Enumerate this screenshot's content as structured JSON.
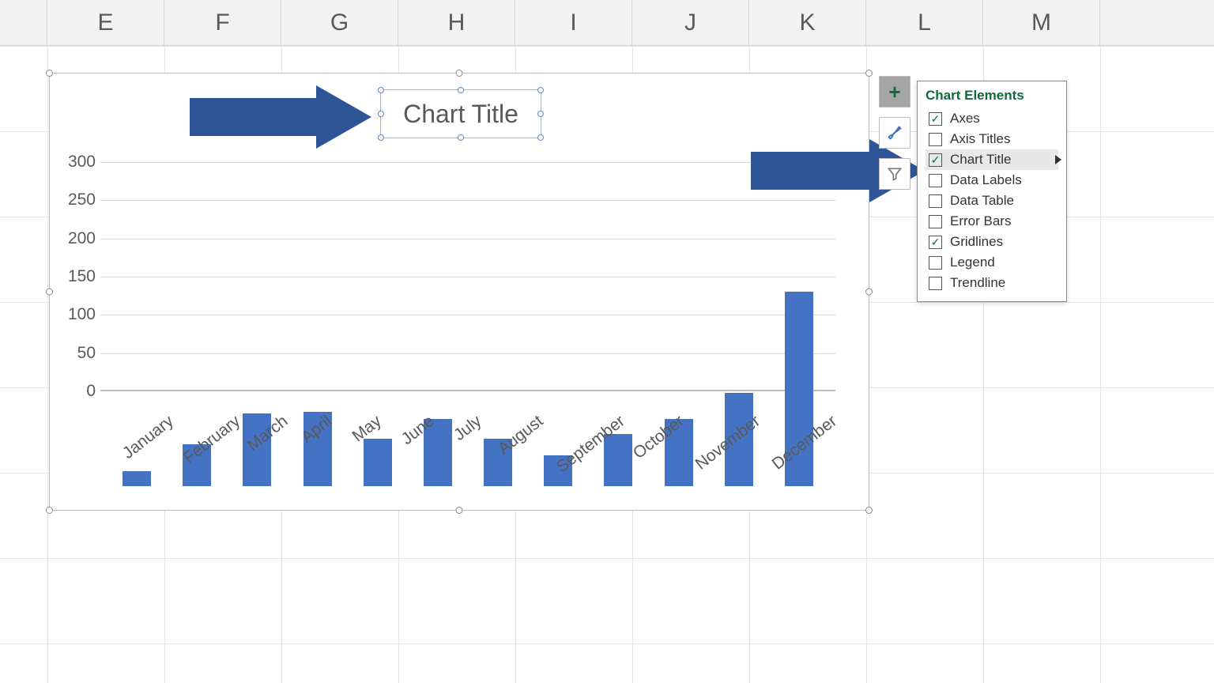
{
  "columns": [
    "E",
    "F",
    "G",
    "H",
    "I",
    "J",
    "K",
    "L",
    "M"
  ],
  "chart": {
    "title": "Chart Title"
  },
  "chart_data": {
    "type": "bar",
    "title": "Chart Title",
    "categories": [
      "January",
      "February",
      "March",
      "April",
      "May",
      "June",
      "July",
      "August",
      "September",
      "October",
      "November",
      "December"
    ],
    "values": [
      20,
      55,
      95,
      97,
      62,
      88,
      62,
      40,
      68,
      88,
      122,
      255
    ],
    "xlabel": "",
    "ylabel": "",
    "ylim": [
      0,
      300
    ],
    "yticks": [
      0,
      50,
      100,
      150,
      200,
      250,
      300
    ]
  },
  "buttons": {
    "plus": "+",
    "brush": "brush",
    "filter": "filter"
  },
  "flyout": {
    "title": "Chart Elements",
    "items": [
      {
        "label": "Axes",
        "checked": true,
        "hovered": false
      },
      {
        "label": "Axis Titles",
        "checked": false,
        "hovered": false
      },
      {
        "label": "Chart Title",
        "checked": true,
        "hovered": true,
        "submenu": true
      },
      {
        "label": "Data Labels",
        "checked": false,
        "hovered": false
      },
      {
        "label": "Data Table",
        "checked": false,
        "hovered": false
      },
      {
        "label": "Error Bars",
        "checked": false,
        "hovered": false
      },
      {
        "label": "Gridlines",
        "checked": true,
        "hovered": false
      },
      {
        "label": "Legend",
        "checked": false,
        "hovered": false
      },
      {
        "label": "Trendline",
        "checked": false,
        "hovered": false
      }
    ]
  },
  "colors": {
    "bar": "#4472c4",
    "arrow": "#2f5597",
    "accent": "#0e6b3a"
  }
}
